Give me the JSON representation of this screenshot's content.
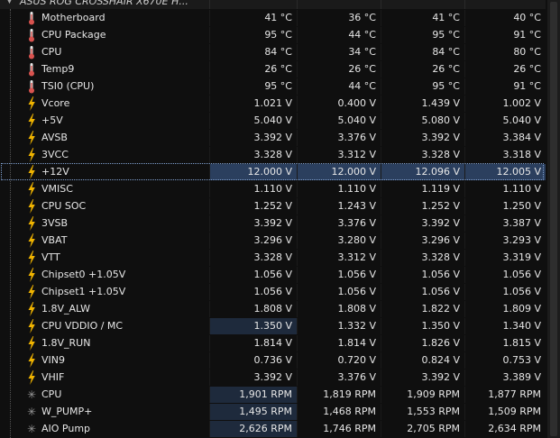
{
  "header": {
    "device_label": "ASUS ROG CROSSHAIR X670E H..."
  },
  "colors": {
    "background": "#0f0f0f",
    "selected_row": "#2b3f5e",
    "highlight_cell": "#1e2a3c",
    "temp_icon": "#d9534f",
    "volt_icon": "#f0b400"
  },
  "rows": [
    {
      "icon": "thermometer-icon",
      "name": "Motherboard",
      "v": [
        "41 °C",
        "36 °C",
        "41 °C",
        "40 °C"
      ]
    },
    {
      "icon": "thermometer-icon",
      "name": "CPU Package",
      "v": [
        "95 °C",
        "44 °C",
        "95 °C",
        "91 °C"
      ]
    },
    {
      "icon": "thermometer-icon",
      "name": "CPU",
      "v": [
        "84 °C",
        "34 °C",
        "84 °C",
        "80 °C"
      ]
    },
    {
      "icon": "thermometer-icon",
      "name": "Temp9",
      "v": [
        "26 °C",
        "26 °C",
        "26 °C",
        "26 °C"
      ]
    },
    {
      "icon": "thermometer-icon",
      "name": "TSI0 (CPU)",
      "v": [
        "95 °C",
        "44 °C",
        "95 °C",
        "91 °C"
      ]
    },
    {
      "icon": "lightning-icon",
      "name": "Vcore",
      "v": [
        "1.021 V",
        "0.400 V",
        "1.439 V",
        "1.002 V"
      ]
    },
    {
      "icon": "lightning-icon",
      "name": "+5V",
      "v": [
        "5.040 V",
        "5.040 V",
        "5.080 V",
        "5.040 V"
      ]
    },
    {
      "icon": "lightning-icon",
      "name": "AVSB",
      "v": [
        "3.392 V",
        "3.376 V",
        "3.392 V",
        "3.384 V"
      ]
    },
    {
      "icon": "lightning-icon",
      "name": "3VCC",
      "v": [
        "3.328 V",
        "3.312 V",
        "3.328 V",
        "3.318 V"
      ]
    },
    {
      "icon": "lightning-icon",
      "name": "+12V",
      "v": [
        "12.000 V",
        "12.000 V",
        "12.096 V",
        "12.005 V"
      ],
      "selected": true
    },
    {
      "icon": "lightning-icon",
      "name": "VMISC",
      "v": [
        "1.110 V",
        "1.110 V",
        "1.119 V",
        "1.110 V"
      ]
    },
    {
      "icon": "lightning-icon",
      "name": "CPU SOC",
      "v": [
        "1.252 V",
        "1.243 V",
        "1.252 V",
        "1.250 V"
      ]
    },
    {
      "icon": "lightning-icon",
      "name": "3VSB",
      "v": [
        "3.392 V",
        "3.376 V",
        "3.392 V",
        "3.387 V"
      ]
    },
    {
      "icon": "lightning-icon",
      "name": "VBAT",
      "v": [
        "3.296 V",
        "3.280 V",
        "3.296 V",
        "3.293 V"
      ]
    },
    {
      "icon": "lightning-icon",
      "name": "VTT",
      "v": [
        "3.328 V",
        "3.312 V",
        "3.328 V",
        "3.319 V"
      ]
    },
    {
      "icon": "lightning-icon",
      "name": "Chipset0 +1.05V",
      "v": [
        "1.056 V",
        "1.056 V",
        "1.056 V",
        "1.056 V"
      ]
    },
    {
      "icon": "lightning-icon",
      "name": "Chipset1 +1.05V",
      "v": [
        "1.056 V",
        "1.056 V",
        "1.056 V",
        "1.056 V"
      ]
    },
    {
      "icon": "lightning-icon",
      "name": "1.8V_ALW",
      "v": [
        "1.808 V",
        "1.808 V",
        "1.822 V",
        "1.809 V"
      ]
    },
    {
      "icon": "lightning-icon",
      "name": "CPU VDDIO / MC",
      "v": [
        "1.350 V",
        "1.332 V",
        "1.350 V",
        "1.340 V"
      ],
      "highlight_first": true
    },
    {
      "icon": "lightning-icon",
      "name": "1.8V_RUN",
      "v": [
        "1.814 V",
        "1.814 V",
        "1.826 V",
        "1.815 V"
      ]
    },
    {
      "icon": "lightning-icon",
      "name": "VIN9",
      "v": [
        "0.736 V",
        "0.720 V",
        "0.824 V",
        "0.753 V"
      ]
    },
    {
      "icon": "lightning-icon",
      "name": "VHIF",
      "v": [
        "3.392 V",
        "3.376 V",
        "3.392 V",
        "3.389 V"
      ]
    },
    {
      "icon": "fan-icon",
      "name": "CPU",
      "v": [
        "1,901 RPM",
        "1,819 RPM",
        "1,909 RPM",
        "1,877 RPM"
      ],
      "highlight_first": true
    },
    {
      "icon": "fan-icon",
      "name": "W_PUMP+",
      "v": [
        "1,495 RPM",
        "1,468 RPM",
        "1,553 RPM",
        "1,509 RPM"
      ],
      "highlight_first": true
    },
    {
      "icon": "fan-icon",
      "name": "AIO Pump",
      "v": [
        "2,626 RPM",
        "1,746 RPM",
        "2,705 RPM",
        "2,634 RPM"
      ],
      "highlight_first": true
    }
  ]
}
